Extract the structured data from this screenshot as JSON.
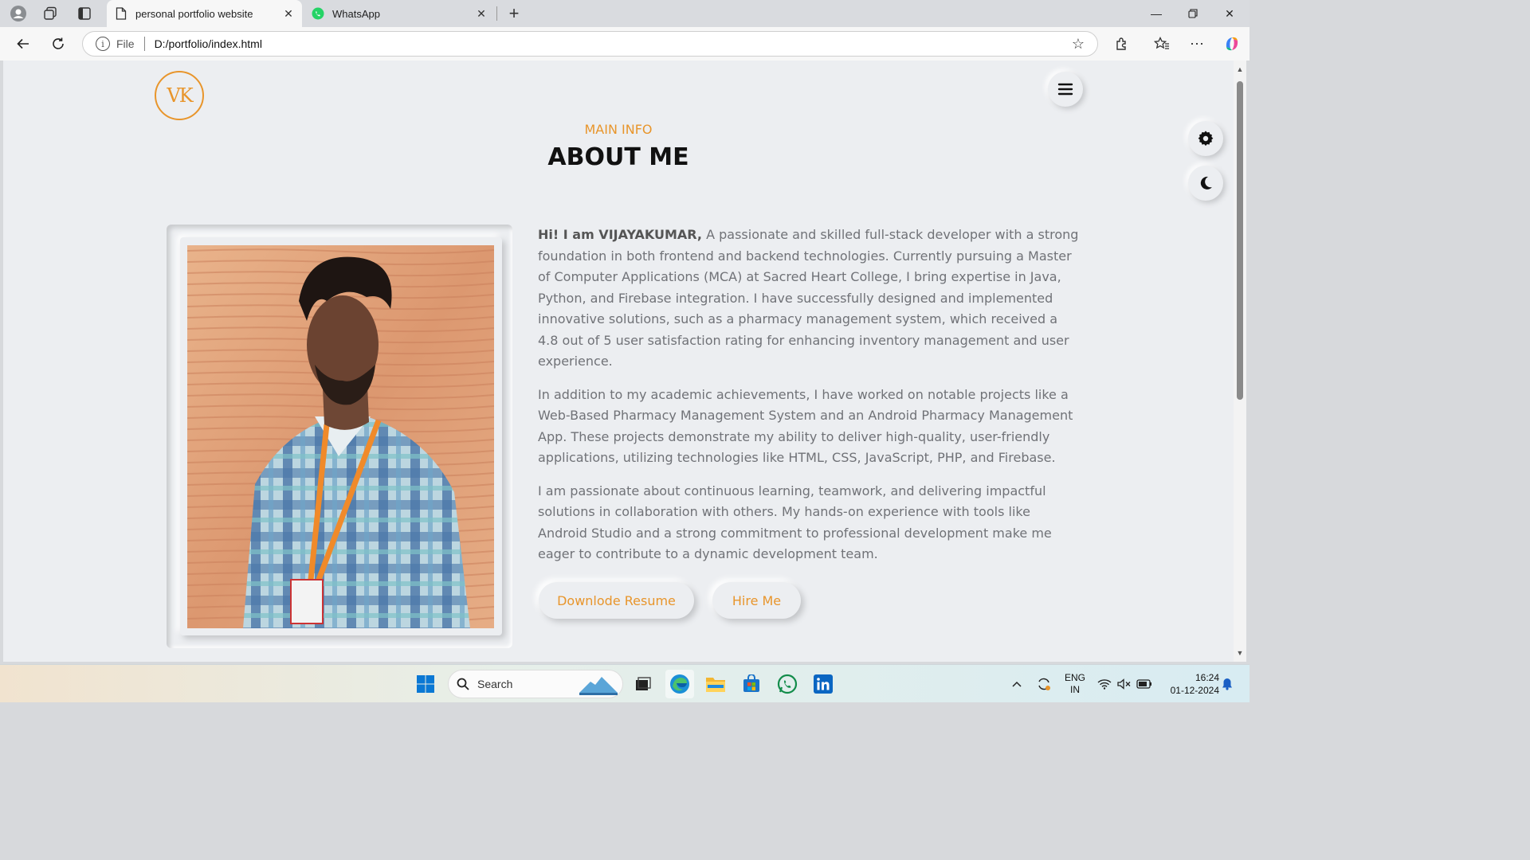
{
  "browser": {
    "tabs": [
      {
        "title": "personal portfolio website",
        "active": true,
        "favicon": "page-icon"
      },
      {
        "title": "WhatsApp",
        "active": false,
        "favicon": "whatsapp-icon"
      }
    ],
    "address": {
      "scheme_label": "File",
      "url": "D:/portfolio/index.html"
    }
  },
  "page": {
    "logo_text": "VK",
    "section_subtitle": "MAIN INFO",
    "section_title": "ABOUT ME",
    "intro_bold": "Hi! I am VIJAYAKUMAR,",
    "paragraph1_rest": " A passionate and skilled full-stack developer with a strong foundation in both frontend and backend technologies. Currently pursuing a Master of Computer Applications (MCA) at Sacred Heart College, I bring expertise in Java, Python, and Firebase integration. I have successfully designed and implemented innovative solutions, such as a pharmacy management system, which received a 4.8 out of 5 user satisfaction rating for enhancing inventory management and user experience.",
    "paragraph2": "In addition to my academic achievements, I have worked on notable projects like a Web-Based Pharmacy Management System and an Android Pharmacy Management App. These projects demonstrate my ability to deliver high-quality, user-friendly applications, utilizing technologies like HTML, CSS, JavaScript, PHP, and Firebase.",
    "paragraph3": "I am passionate about continuous learning, teamwork, and delivering impactful solutions in collaboration with others. My hands-on experience with tools like Android Studio and a strong commitment to professional development make me eager to contribute to a dynamic development team.",
    "buttons": {
      "resume": "Downlode Resume",
      "hire": "Hire Me"
    },
    "accent_color": "#e8952b"
  },
  "taskbar": {
    "search_label": "Search",
    "lang_top": "ENG",
    "lang_bottom": "IN",
    "time": "16:24",
    "date": "01-12-2024"
  }
}
